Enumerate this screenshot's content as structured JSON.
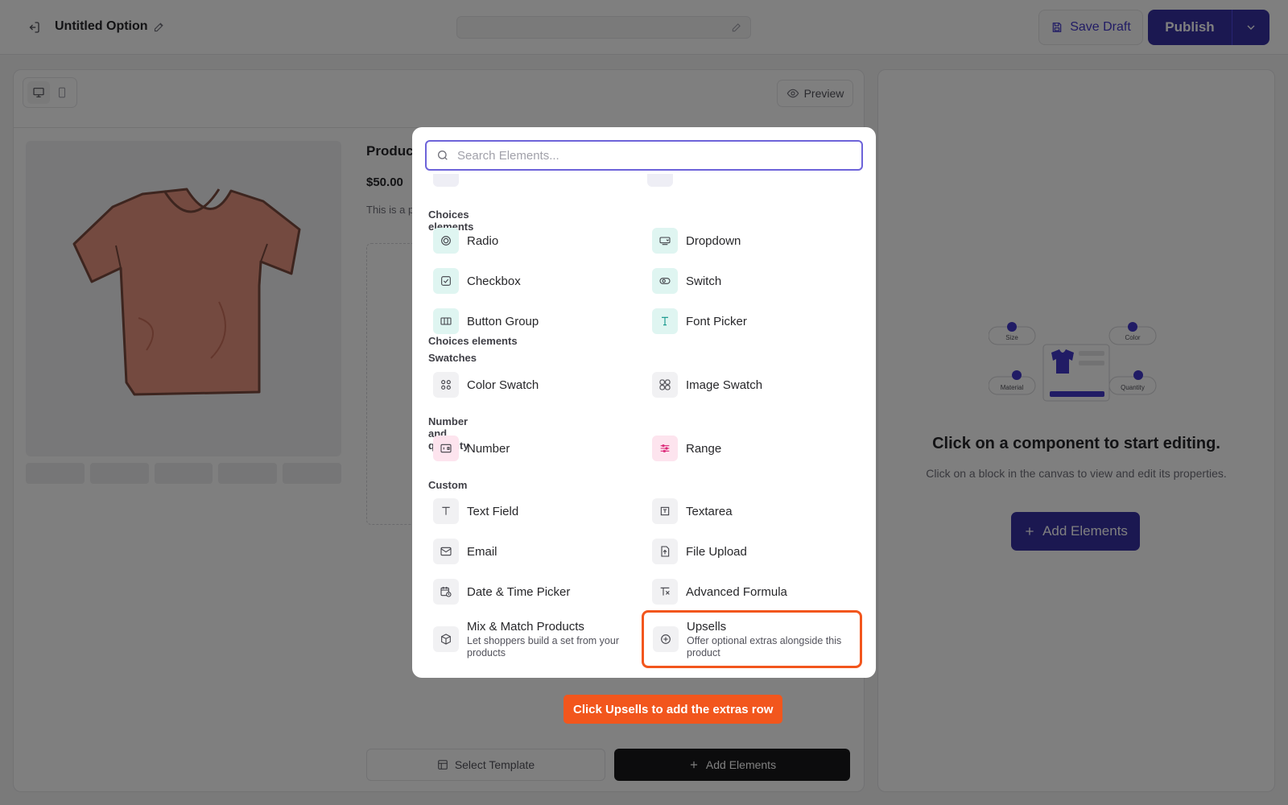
{
  "header": {
    "title": "Untitled Option",
    "save_draft": "Save Draft",
    "publish": "Publish"
  },
  "canvas": {
    "preview": "Preview",
    "product_title": "Produc",
    "product_price": "$50.00",
    "product_desc": "This is a p Elements",
    "select_template": "Select Template",
    "add_elements": "Add Elements"
  },
  "right_panel": {
    "illustration_labels": {
      "size": "Size",
      "color": "Color",
      "material": "Material",
      "quantity": "Quantity"
    },
    "empty_title": "Click on a component to start editing.",
    "empty_subtitle": "Click on a block in the canvas to view and edit its properties.",
    "add_elements": "Add Elements"
  },
  "modal": {
    "search_placeholder": "Search Elements...",
    "sections": {
      "choices": "Choices elements",
      "swatches": "Swatches",
      "number": "Number and quantity",
      "custom": "Custom"
    },
    "items": {
      "radio": "Radio",
      "dropdown": "Dropdown",
      "checkbox": "Checkbox",
      "switch": "Switch",
      "button_group": "Button Group",
      "font_picker": "Font Picker",
      "color_swatch": "Color Swatch",
      "image_swatch": "Image Swatch",
      "number": "Number",
      "range": "Range",
      "text_field": "Text Field",
      "textarea": "Textarea",
      "email": "Email",
      "file_upload": "File Upload",
      "date_time": "Date & Time Picker",
      "advanced_formula": "Advanced Formula",
      "mix_match": "Mix & Match Products",
      "mix_match_desc": "Let shoppers build a set from your products",
      "upsells": "Upsells",
      "upsells_desc": "Offer optional extras alongside this product"
    }
  },
  "hint": "Click Upsells to add the extras row",
  "colors": {
    "primary": "#3730a3",
    "accent_orange": "#f2561d",
    "teal_icon_bg": "#dff5f1",
    "pink_icon_bg": "#fde4ee"
  }
}
